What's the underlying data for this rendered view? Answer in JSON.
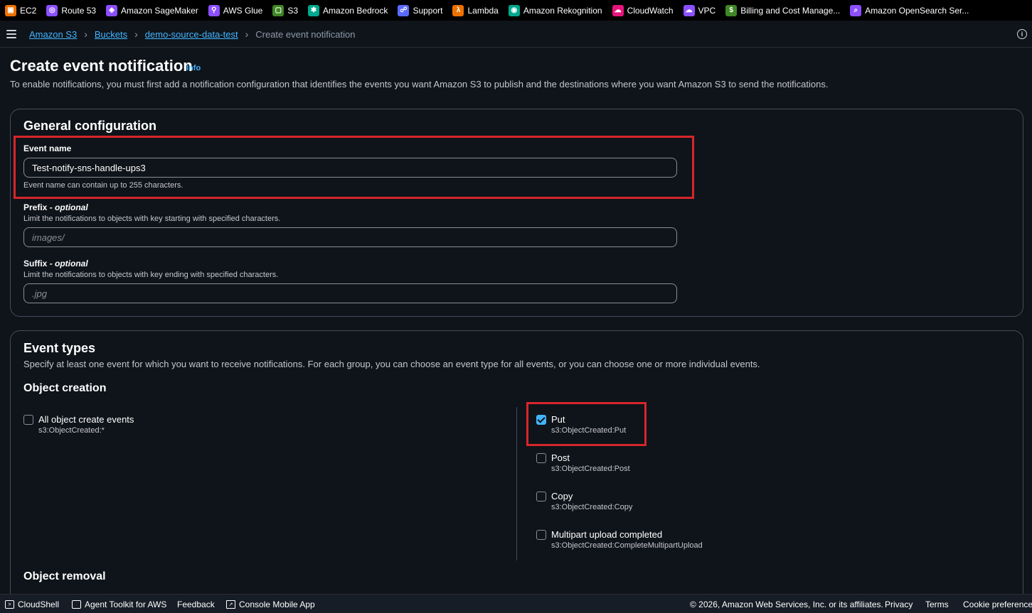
{
  "favorites": [
    {
      "label": "EC2",
      "icon": "ec2-icon",
      "color": "#ed7100"
    },
    {
      "label": "Route 53",
      "icon": "route53-icon",
      "color": "#8c4fff"
    },
    {
      "label": "Amazon SageMaker",
      "icon": "sagemaker-icon",
      "color": "#8c4fff"
    },
    {
      "label": "AWS Glue",
      "icon": "glue-icon",
      "color": "#8c4fff"
    },
    {
      "label": "S3",
      "icon": "s3-icon",
      "color": "#3f8624"
    },
    {
      "label": "Amazon Bedrock",
      "icon": "bedrock-icon",
      "color": "#01a88d"
    },
    {
      "label": "Support",
      "icon": "support-icon",
      "color": "#5a6bff"
    },
    {
      "label": "Lambda",
      "icon": "lambda-icon",
      "color": "#ed7100"
    },
    {
      "label": "Amazon Rekognition",
      "icon": "rekognition-icon",
      "color": "#01a88d"
    },
    {
      "label": "CloudWatch",
      "icon": "cloudwatch-icon",
      "color": "#e7157b"
    },
    {
      "label": "VPC",
      "icon": "vpc-icon",
      "color": "#8c4fff"
    },
    {
      "label": "Billing and Cost Manage...",
      "icon": "billing-icon",
      "color": "#3f8624"
    },
    {
      "label": "Amazon OpenSearch Ser...",
      "icon": "opensearch-icon",
      "color": "#8c4fff"
    }
  ],
  "breadcrumb": {
    "items": [
      "Amazon S3",
      "Buckets",
      "demo-source-data-test"
    ],
    "current": "Create event notification"
  },
  "header": {
    "title": "Create event notification",
    "info": "Info",
    "description": "To enable notifications, you must first add a notification configuration that identifies the events you want Amazon S3 to publish and the destinations where you want Amazon S3 to send the notifications."
  },
  "general": {
    "title": "General configuration",
    "event_name": {
      "label": "Event name",
      "value": "Test-notify-sns-handle-ups3",
      "hint": "Event name can contain up to 255 characters."
    },
    "prefix": {
      "label": "Prefix",
      "optional": "- optional",
      "hint": "Limit the notifications to objects with key starting with specified characters.",
      "placeholder": "images/"
    },
    "suffix": {
      "label": "Suffix",
      "optional": "- optional",
      "hint": "Limit the notifications to objects with key ending with specified characters.",
      "placeholder": ".jpg"
    }
  },
  "event_types": {
    "title": "Event types",
    "description": "Specify at least one event for which you want to receive notifications. For each group, you can choose an event type for all events, or you can choose one or more individual events.",
    "object_creation": {
      "title": "Object creation",
      "all": {
        "label": "All object create events",
        "sub": "s3:ObjectCreated:*",
        "checked": false
      },
      "options": [
        {
          "label": "Put",
          "sub": "s3:ObjectCreated:Put",
          "checked": true
        },
        {
          "label": "Post",
          "sub": "s3:ObjectCreated:Post",
          "checked": false
        },
        {
          "label": "Copy",
          "sub": "s3:ObjectCreated:Copy",
          "checked": false
        },
        {
          "label": "Multipart upload completed",
          "sub": "s3:ObjectCreated:CompleteMultipartUpload",
          "checked": false
        }
      ]
    },
    "object_removal": {
      "title": "Object removal"
    }
  },
  "footer": {
    "cloudshell": "CloudShell",
    "agent_toolkit": "Agent Toolkit for AWS",
    "feedback": "Feedback",
    "mobile_app": "Console Mobile App",
    "copyright": "© 2026, Amazon Web Services, Inc. or its affiliates.",
    "privacy": "Privacy",
    "terms": "Terms",
    "cookie": "Cookie preferences"
  },
  "colors": {
    "accent": "#42b4ff",
    "highlight": "#d6262b",
    "background": "#0f141a"
  }
}
